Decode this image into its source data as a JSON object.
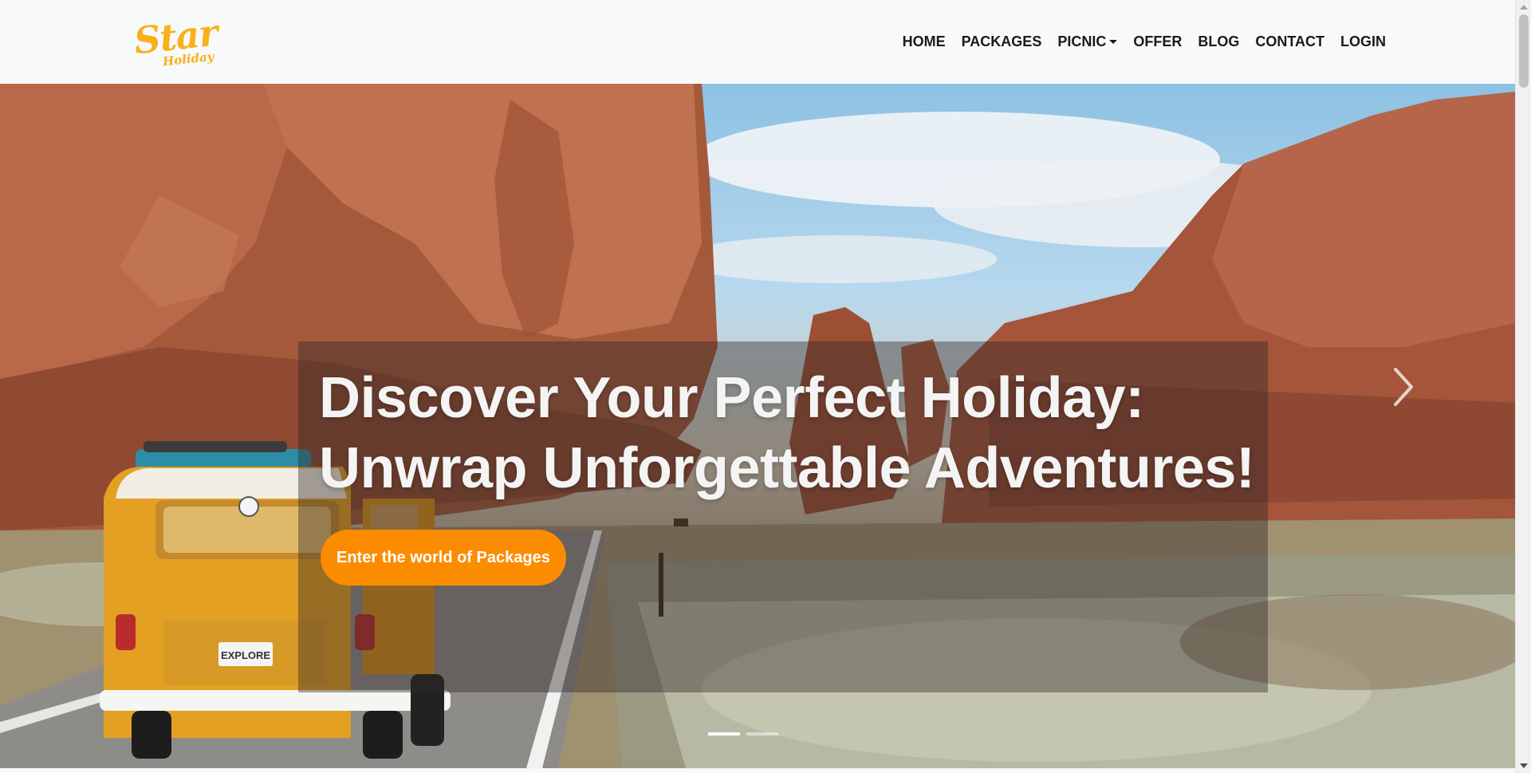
{
  "brand": {
    "name": "Star",
    "tagline": "Holiday"
  },
  "nav": {
    "items": [
      {
        "label": "HOME"
      },
      {
        "label": "PACKAGES"
      },
      {
        "label": "PICNIC",
        "dropdown": true
      },
      {
        "label": "OFFER"
      },
      {
        "label": "BLOG"
      },
      {
        "label": "CONTACT"
      },
      {
        "label": "LOGIN"
      }
    ]
  },
  "hero": {
    "title_line1": "Discover Your Perfect Holiday:",
    "title_line2": "Unwrap Unforgettable Adventures!",
    "cta_label": "Enter the world of Packages",
    "van_plate": "EXPLORE",
    "slide_count": 2,
    "active_slide": 1
  },
  "colors": {
    "brand": "#f7b21b",
    "cta": "#fb8c00",
    "nav_text": "#1a1a1a",
    "hero_text": "#f4f4f4"
  },
  "icons": [
    "chevron-right-icon",
    "chevron-down-icon"
  ]
}
